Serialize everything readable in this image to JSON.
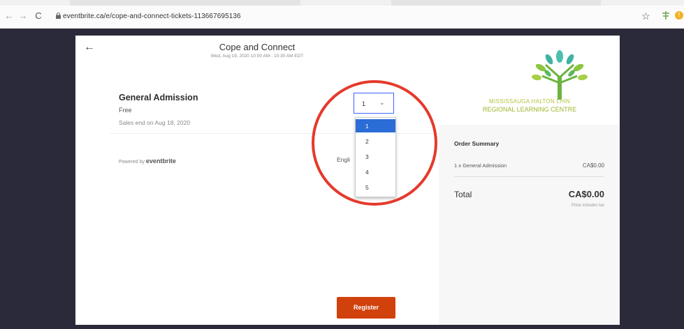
{
  "browser": {
    "url": "eventbrite.ca/e/cope-and-connect-tickets-113667695136"
  },
  "modal": {
    "title": "Cope and Connect",
    "subtitle": "Wed, Aug 19, 2020 10:00 AM - 10:30 AM EDT",
    "ticket": {
      "name": "General Admission",
      "price": "Free",
      "sales": "Sales end on Aug 18, 2020"
    },
    "quantity": {
      "selected": "1",
      "options": [
        "1",
        "2",
        "3",
        "4",
        "5"
      ]
    },
    "powered_prefix": "Powered by",
    "powered_brand": "eventbrite",
    "language": "Engli",
    "register_label": "Register",
    "org_name_line1": "MISSISSAUGA HALTON LHIN",
    "org_name_line2": "REGIONAL LEARNING CENTRE",
    "order": {
      "title": "Order Summary",
      "line_label": "1 x General Admission",
      "line_amount": "CA$0.00",
      "total_label": "Total",
      "total_amount": "CA$0.00",
      "tax_note": "Price includes tax"
    }
  },
  "colors": {
    "accent": "#d1410c",
    "select_border": "#3d64ff",
    "selected_option": "#2b6cd6",
    "annotation_circle": "#e53a2c"
  }
}
